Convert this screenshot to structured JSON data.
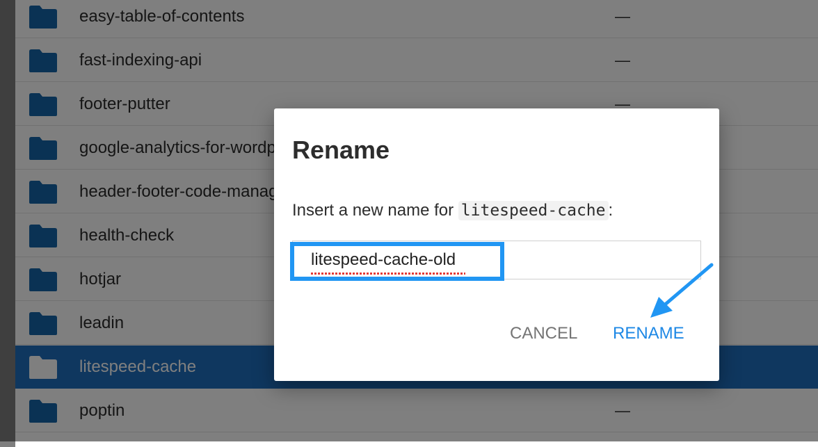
{
  "file_list": {
    "rows": [
      {
        "name": "easy-table-of-contents",
        "size": "—",
        "selected": false
      },
      {
        "name": "fast-indexing-api",
        "size": "—",
        "selected": false
      },
      {
        "name": "footer-putter",
        "size": "—",
        "selected": false
      },
      {
        "name": "google-analytics-for-wordpress",
        "size": "",
        "selected": false
      },
      {
        "name": "header-footer-code-manager",
        "size": "",
        "selected": false
      },
      {
        "name": "health-check",
        "size": "",
        "selected": false
      },
      {
        "name": "hotjar",
        "size": "",
        "selected": false
      },
      {
        "name": "leadin",
        "size": "",
        "selected": false
      },
      {
        "name": "litespeed-cache",
        "size": "",
        "selected": true
      },
      {
        "name": "poptin",
        "size": "—",
        "selected": false
      }
    ]
  },
  "dialog": {
    "title": "Rename",
    "message_prefix": "Insert a new name for ",
    "current_name": "litespeed-cache",
    "message_suffix": ":",
    "input_value": "litespeed-cache-old",
    "cancel_label": "CANCEL",
    "rename_label": "RENAME"
  },
  "colors": {
    "folder": "#1565a8",
    "selected_row": "#1e6fbf",
    "accent": "#1e88e5",
    "annotation": "#2196f3"
  },
  "icons": {
    "folder": "folder-icon",
    "annotation_arrow": "arrow-icon"
  }
}
